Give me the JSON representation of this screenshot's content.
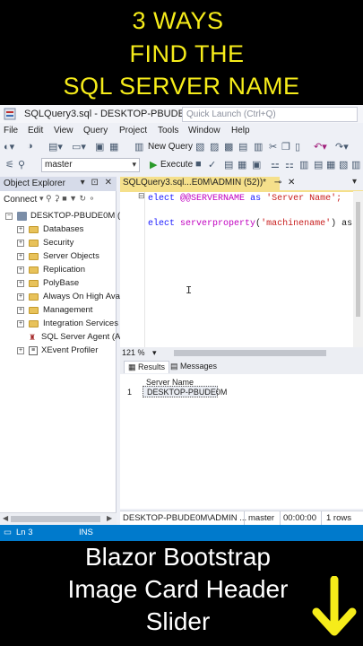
{
  "overlay_top": {
    "line1": "3 WAYS",
    "line2": "FIND THE",
    "line3": "SQL SERVER NAME"
  },
  "window": {
    "title": "SQLQuery3.sql - DESKTOP-PBUDE0M.m...",
    "quick_launch_placeholder": "Quick Launch (Ctrl+Q)"
  },
  "menu": [
    "File",
    "Edit",
    "View",
    "Query",
    "Project",
    "Tools",
    "Window",
    "Help"
  ],
  "toolbar": {
    "new_query": "New Query",
    "database": "master",
    "execute": "Execute"
  },
  "object_explorer": {
    "title": "Object Explorer",
    "connect": "Connect",
    "root": "DESKTOP-PBUDE0M (S",
    "items": [
      "Databases",
      "Security",
      "Server Objects",
      "Replication",
      "PolyBase",
      "Always On High Ava",
      "Management",
      "Integration Services",
      "SQL Server Agent (A",
      "XEvent Profiler"
    ]
  },
  "editor": {
    "tab_label": "SQLQuery3.sql...E0M\\ADMIN (52))*",
    "line1": {
      "kw": "elect",
      "var": "@@SERVERNAME",
      "as": "as",
      "str": "'Server Name';"
    },
    "line2": {
      "kw": "elect",
      "fn": "serverproperty",
      "paren_open": "(",
      "str": "'machinename'",
      "rest": ") as"
    },
    "zoom": "121 %"
  },
  "results": {
    "tab_results": "Results",
    "tab_messages": "Messages",
    "column_header": "Server Name",
    "row_number": "1",
    "cell_value": "DESKTOP-PBUDE0M"
  },
  "query_status": {
    "server": "DESKTOP-PBUDE0M\\ADMIN ...",
    "database": "master",
    "time": "00:00:00",
    "rows": "1 rows"
  },
  "statusbar": {
    "line": "Ln 3",
    "mode": "INS"
  },
  "overlay_bottom": {
    "line1": "Blazor Bootstrap",
    "line2": "Image Card Header",
    "line3": "Slider"
  },
  "colors": {
    "overlay_title": "#f6ec1a",
    "arrow": "#f6ec1a",
    "statusbar": "#007acc",
    "tab": "#f5e08b"
  }
}
